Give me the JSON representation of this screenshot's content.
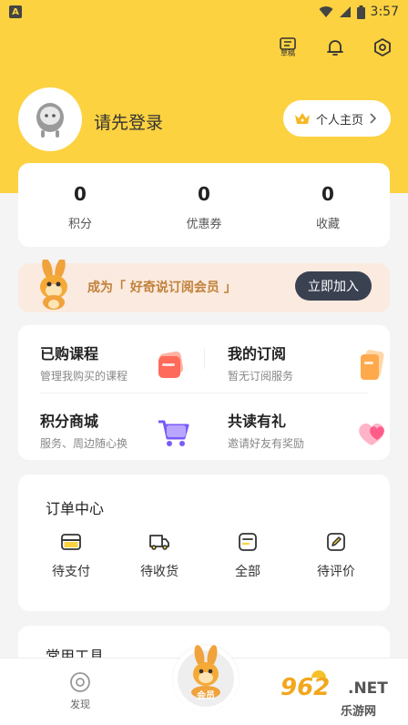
{
  "status_bar": {
    "time": "3:57",
    "app_badge": "A"
  },
  "header": {
    "draft_label": "草稿",
    "login_prompt": "请先登录",
    "profile_button": "个人主页"
  },
  "stats": [
    {
      "value": "0",
      "label": "积分"
    },
    {
      "value": "0",
      "label": "优惠券"
    },
    {
      "value": "0",
      "label": "收藏"
    }
  ],
  "vip_banner": {
    "text": "成为「 好奇说订阅会员 」",
    "button": "立即加入"
  },
  "features": [
    {
      "title": "已购课程",
      "subtitle": "管理我购买的课程"
    },
    {
      "title": "我的订阅",
      "subtitle": "暂无订阅服务"
    },
    {
      "title": "积分商城",
      "subtitle": "服务、周边随心换"
    },
    {
      "title": "共读有礼",
      "subtitle": "邀请好友有奖励"
    }
  ],
  "orders": {
    "title": "订单中心",
    "items": [
      {
        "label": "待支付"
      },
      {
        "label": "待收货"
      },
      {
        "label": "全部"
      },
      {
        "label": "待评价"
      }
    ]
  },
  "tools": {
    "title": "常用工具"
  },
  "bottom_nav": {
    "discover": "发现",
    "vip": "会员"
  },
  "watermark": {
    "main": "962",
    "net": ".NET",
    "sub": "乐游网"
  },
  "colors": {
    "brand_yellow": "#fcd240",
    "vip_button": "#3a4151",
    "vip_text": "#c1813b"
  }
}
